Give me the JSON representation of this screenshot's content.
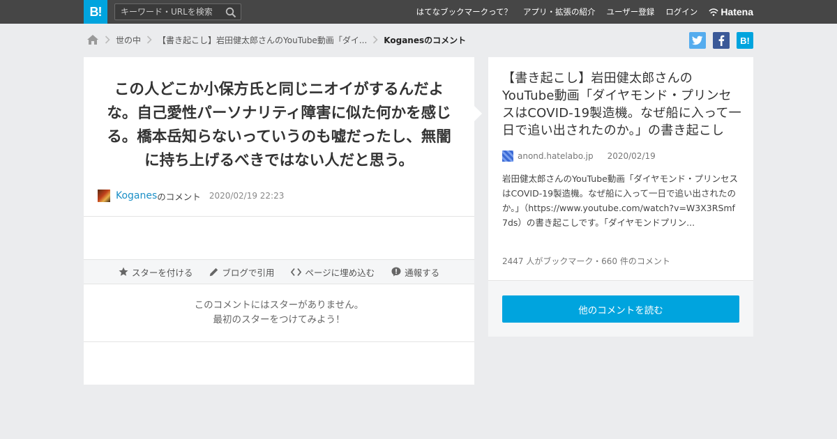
{
  "header": {
    "logo": "B!",
    "search_placeholder": "キーワード・URLを検索",
    "nav": [
      "はてなブックマークって？",
      "アプリ・拡張の紹介",
      "ユーザー登録",
      "ログイン"
    ],
    "brand": "Hatena"
  },
  "breadcrumb": {
    "items": [
      "世の中",
      "【書き起こし】岩田健太郎さんのYouTube動画「ダイ..."
    ],
    "current": "Koganesのコメント"
  },
  "social": {
    "twitter": "t",
    "facebook": "f",
    "hatena": "B!"
  },
  "comment": {
    "text": "この人どこか小保方氏と同じニオイがするんだよな。自己愛性パーソナリティ障害に似た何かを感じる。橋本岳知らないっていうのも嘘だったし、無闇に持ち上げるべきではない人だと思う。",
    "user": "Koganes",
    "user_suffix": "のコメント",
    "timestamp": "2020/02/19 22:23"
  },
  "actions": {
    "star": "スターを付ける",
    "quote": "ブログで引用",
    "embed": "ページに埋め込む",
    "report": "通報する"
  },
  "no_star": {
    "line1": "このコメントにはスターがありません。",
    "line2": "最初のスターをつけてみよう！"
  },
  "entry": {
    "title": "【書き起こし】岩田健太郎さんのYouTube動画「ダイヤモンド・プリンセスはCOVID-19製造機。なぜ船に入って一日で追い出されたのか。」の書き起こし",
    "site": "anond.hatelabo.jp",
    "date": "2020/02/19",
    "summary": "岩田健太郎さんのYouTube動画「ダイヤモンド・プリンセスはCOVID-19製造機。なぜ船に入って一日で追い出されたのか。」（https://www.youtube.com/watch?v=W3X3RSmf7ds）の書き起こしです。「ダイヤモンドプリン...",
    "stats": "2447 人がブックマーク・660 件のコメント",
    "read_button": "他のコメントを読む"
  },
  "colors": {
    "accent": "#00a4de",
    "topbar": "#464646",
    "twitter": "#55acee",
    "facebook": "#3b5998"
  }
}
